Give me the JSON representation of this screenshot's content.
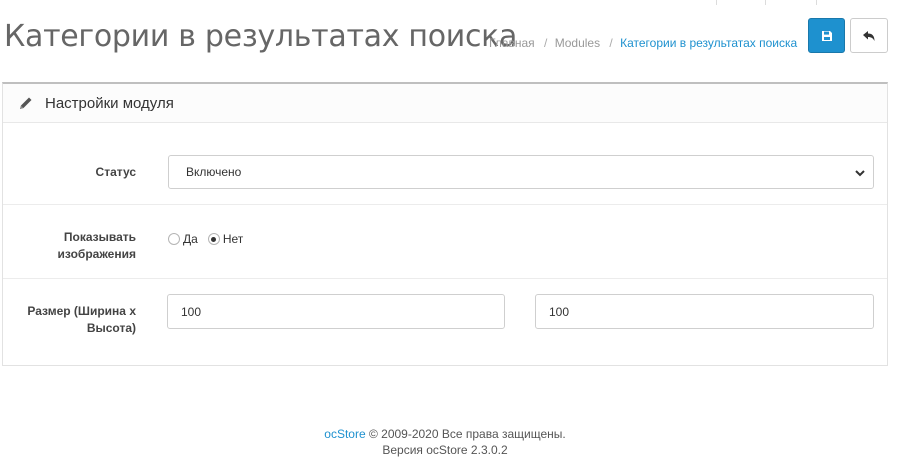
{
  "header": {
    "title": "Категории в результатах поиска",
    "breadcrumb": [
      "Главная",
      "Modules",
      "Категории в результатах поиска"
    ],
    "breadcrumb_separator": "/",
    "save_icon": "floppy-disk-icon",
    "back_icon": "reply-arrow-icon",
    "accent_color": "#1e91cf"
  },
  "panel": {
    "title": "Настройки модуля",
    "title_icon": "pencil-icon"
  },
  "form": {
    "status": {
      "label": "Статус",
      "selected": "Включено"
    },
    "show_images": {
      "label_line1": "Показывать",
      "label_line2": "изображения",
      "option_yes": "Да",
      "option_no": "Нет",
      "selected": "Нет"
    },
    "size": {
      "label_line1": "Размер (Ширина х",
      "label_line2": "Высота)",
      "width": "100",
      "height": "100"
    }
  },
  "footer": {
    "brand": "ocStore",
    "copyright": "© 2009-2020 Все права защищены.",
    "version": "Версия ocStore 2.3.0.2"
  }
}
